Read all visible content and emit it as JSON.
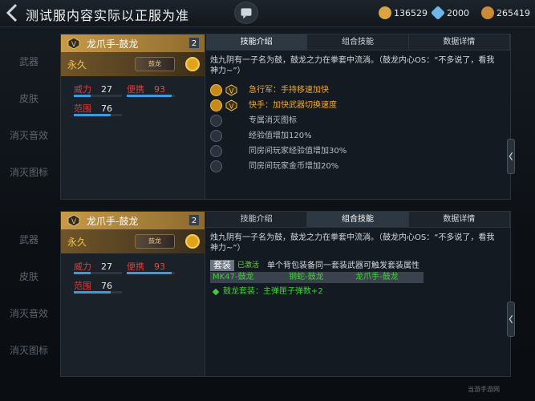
{
  "header": {
    "title": "测试服内容实际以正服为准",
    "currencies": [
      {
        "icon": "gold-ticket-icon",
        "value": "136529",
        "color": "#d9a441"
      },
      {
        "icon": "diamond-icon",
        "value": "2000",
        "color": "#6fb7e6"
      },
      {
        "icon": "coin-icon",
        "value": "265419",
        "color": "#c98a3a"
      }
    ]
  },
  "sidebar": {
    "items": [
      "武器",
      "皮肤",
      "消灭音效",
      "消灭图标"
    ]
  },
  "panels": [
    {
      "weapon": {
        "name": "龙爪手-鼓龙",
        "count": "2",
        "permanence": "永久",
        "img_text": "鼓龙",
        "stats": [
          {
            "label": "威力",
            "value": "27",
            "fill": 0.35
          },
          {
            "label": "便携",
            "value": "93",
            "fill": 0.93
          },
          {
            "label": "范围",
            "value": "76",
            "fill": 0.76
          }
        ]
      },
      "tabs": [
        "技能介绍",
        "组合技能",
        "数据详情"
      ],
      "active_tab": 0,
      "description": "烛九阴有一子名为鼓，鼓龙之力在拳套中流淌。（鼓龙内心OS：“不多说了，看我神力~”）",
      "skills": [
        {
          "text": "急行军：手持移速加快",
          "color": "orange"
        },
        {
          "text": "快手：加快武器切换速度",
          "color": "orange"
        },
        {
          "text": "专属消灭图标",
          "color": "grey"
        },
        {
          "text": "经验值增加120%",
          "color": "grey"
        },
        {
          "text": "同房间玩家经验值增加30%",
          "color": "grey"
        },
        {
          "text": "同房间玩家金币增加20%",
          "color": "grey"
        }
      ]
    },
    {
      "weapon": {
        "name": "龙爪手-鼓龙",
        "count": "2",
        "permanence": "永久",
        "img_text": "鼓龙",
        "stats": [
          {
            "label": "威力",
            "value": "27",
            "fill": 0.35
          },
          {
            "label": "便携",
            "value": "93",
            "fill": 0.93
          },
          {
            "label": "范围",
            "value": "76",
            "fill": 0.76
          }
        ]
      },
      "tabs": [
        "技能介绍",
        "组合技能",
        "数据详情"
      ],
      "active_tab": 1,
      "description": "烛九阴有一子名为鼓，鼓龙之力在拳套中流淌。（鼓龙内心OS：“不多说了，看我神力~”）",
      "set": {
        "tag": "套装",
        "status": "已激活",
        "note": "单个背包装备同一套装武器可触发套装属性",
        "items": [
          "MK47-鼓龙",
          "钢蛇-鼓龙",
          "龙爪手-鼓龙"
        ],
        "bonus": "鼓龙套装：主弹匣子弹数+2"
      }
    }
  ],
  "watermark": "当游手游网"
}
